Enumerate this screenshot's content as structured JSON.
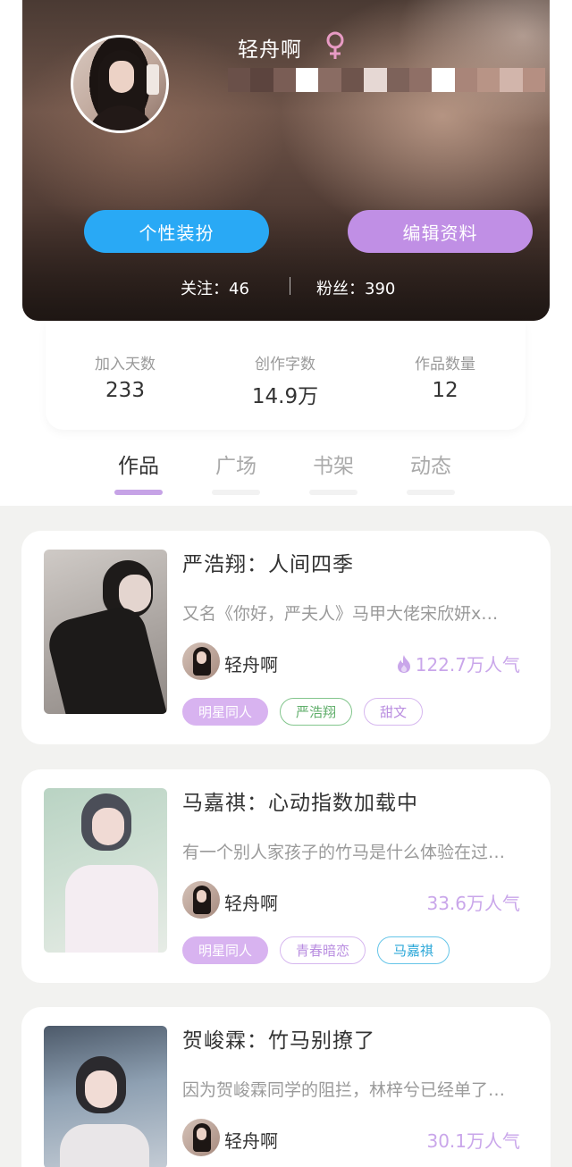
{
  "profile": {
    "username": "轻舟啊",
    "gender_icon": "female-symbol-icon",
    "buttons": {
      "style": "个性装扮",
      "edit": "编辑资料"
    },
    "follow_label": "关注：",
    "follow_count": "46",
    "fans_label": "粉丝：",
    "fans_count": "390"
  },
  "stats": [
    {
      "label": "加入天数",
      "value": "233"
    },
    {
      "label": "创作字数",
      "value": "14.9万"
    },
    {
      "label": "作品数量",
      "value": "12"
    }
  ],
  "tabs": [
    "作品",
    "广场",
    "书架",
    "动态"
  ],
  "active_tab": "作品",
  "works": [
    {
      "title": "严浩翔：人间四季",
      "desc": "又名《你好，严夫人》马甲大佬宋欣妍x…",
      "author": "轻舟啊",
      "popularity": "122.7万人气",
      "hot_icon": true,
      "tags": [
        "明星同人",
        "严浩翔",
        "甜文"
      ]
    },
    {
      "title": "马嘉祺：心动指数加载中",
      "desc": "有一个别人家孩子的竹马是什么体验在过…",
      "author": "轻舟啊",
      "popularity": "33.6万人气",
      "hot_icon": false,
      "tags": [
        "明星同人",
        "青春暗恋",
        "马嘉祺"
      ]
    },
    {
      "title": "贺峻霖：竹马别撩了",
      "desc": "因为贺峻霖同学的阻拦，林梓兮已经单了…",
      "author": "轻舟啊",
      "popularity": "30.1万人气",
      "hot_icon": false,
      "tags": []
    }
  ],
  "colors": {
    "primary_blue": "#29a9f5",
    "primary_purple": "#c08fe5",
    "popularity": "#c9a6ea",
    "tab_indicator": "#c6a3e6"
  }
}
